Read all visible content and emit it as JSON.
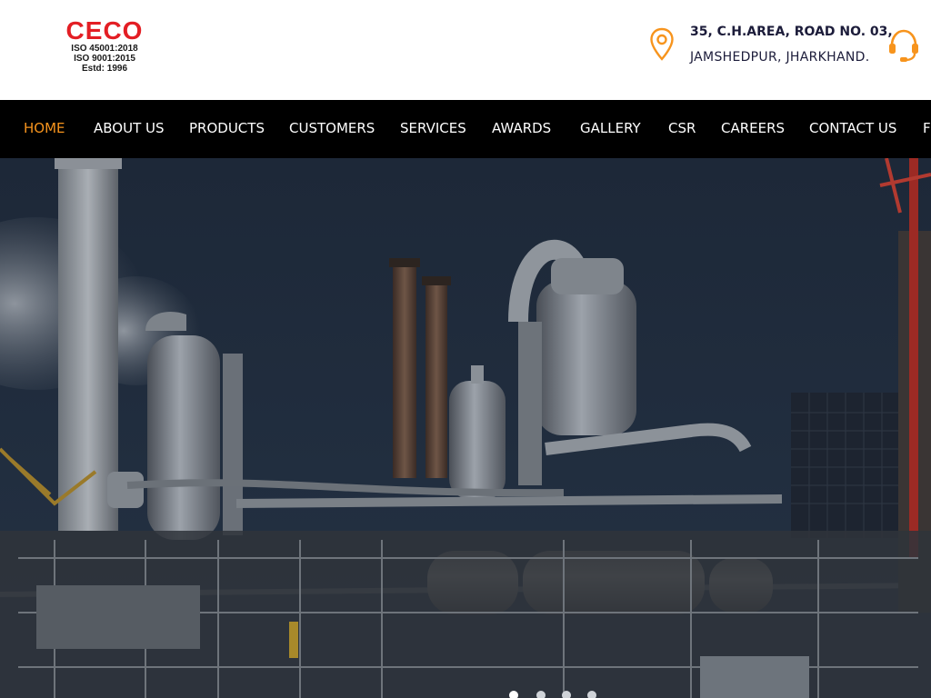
{
  "header": {
    "logo": {
      "name": "CECO",
      "line1": "ISO 45001:2018",
      "line2": "ISO 9001:2015",
      "line3": "Estd: 1996"
    },
    "address": {
      "line1": "35, C.H.AREA, ROAD NO. 03,",
      "line2": "JAMSHEDPUR, JHARKHAND."
    },
    "icons": {
      "location": "map-pin-icon",
      "support": "headset-icon",
      "accent_color": "#f7941d"
    }
  },
  "nav": {
    "items": [
      {
        "label": "HOME",
        "active": true
      },
      {
        "label": "ABOUT US"
      },
      {
        "label": "PRODUCTS"
      },
      {
        "label": "CUSTOMERS"
      },
      {
        "label": "SERVICES"
      },
      {
        "label": "AWARDS"
      },
      {
        "label": "GALLERY"
      },
      {
        "label": "CSR"
      },
      {
        "label": "CAREERS"
      },
      {
        "label": "CONTACT US"
      },
      {
        "label": "F"
      }
    ],
    "active_color": "#f7941d"
  },
  "hero": {
    "image": "industrial-plant-photo",
    "slider": {
      "count": 4,
      "active_index": 0
    }
  },
  "colors": {
    "brand_red": "#e31e24",
    "nav_bg": "#000000",
    "text_dark": "#1c1c3a"
  }
}
